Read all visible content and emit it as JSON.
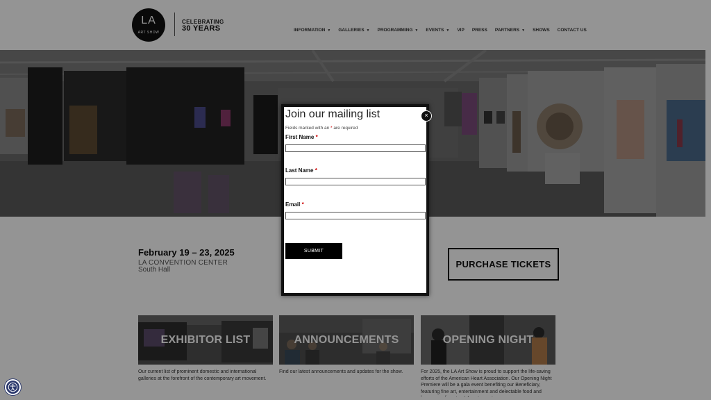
{
  "header": {
    "logo_main": "LA",
    "logo_sub": "ART SHOW",
    "tagline_top": "CELEBRATING",
    "tagline_bottom": "30 YEARS"
  },
  "nav": [
    {
      "label": "INFORMATION",
      "dropdown": true
    },
    {
      "label": "GALLERIES",
      "dropdown": true
    },
    {
      "label": "PROGRAMMING",
      "dropdown": true
    },
    {
      "label": "EVENTS",
      "dropdown": true
    },
    {
      "label": "VIP",
      "dropdown": false
    },
    {
      "label": "PRESS",
      "dropdown": false
    },
    {
      "label": "PARTNERS",
      "dropdown": true
    },
    {
      "label": "SHOWS",
      "dropdown": false
    },
    {
      "label": "CONTACT US",
      "dropdown": false
    }
  ],
  "event": {
    "dates": "February 19 – 23, 2025",
    "venue": "LA CONVENTION CENTER",
    "hall": "South Hall",
    "tickets_label": "PURCHASE TICKETS"
  },
  "cards": [
    {
      "title": "EXHIBITOR LIST",
      "description": "Our current list of prominent domestic and international galleries at the forefront of the contemporary art movement."
    },
    {
      "title": "ANNOUNCEMENTS",
      "description": "Find our latest announcements and updates for the show."
    },
    {
      "title": "OPENING NIGHT",
      "description": "For 2025, the LA Art Show is proud to support the life-saving efforts of the American Heart Association. Our Opening Night Premiere will be a gala event benefiting our Beneficiary, featuring fine art, entertainment and delectable food and beverages from top LA restaurants."
    }
  ],
  "modal": {
    "title": "Join our mailing list",
    "required_note_prefix": "Fields marked with an ",
    "required_star": "*",
    "required_note_suffix": " are required",
    "first_name_label": "First Name",
    "last_name_label": "Last Name",
    "email_label": "Email",
    "submit_label": "SUBMIT",
    "close_symbol": "×"
  },
  "icons": {
    "dropdown": "chevron-down-icon",
    "close": "close-icon",
    "accessibility": "accessibility-icon"
  },
  "colors": {
    "overlay": "#000000",
    "button_dark": "#000000",
    "accessibility": "#2d3a6e",
    "required": "#cc0000"
  }
}
